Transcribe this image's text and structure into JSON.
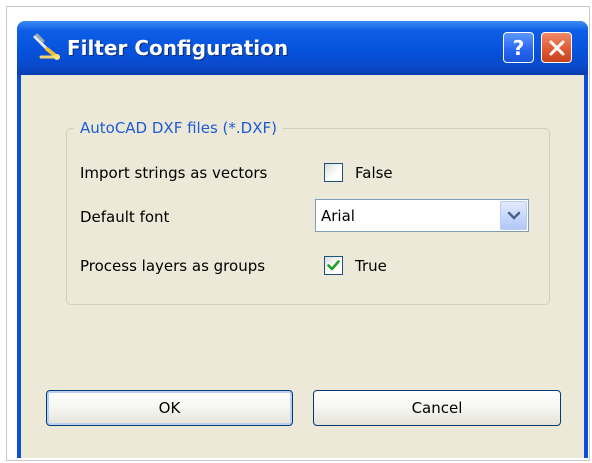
{
  "window": {
    "title": "Filter Configuration",
    "help_symbol": "?",
    "icon": "filter-wand-icon"
  },
  "group": {
    "title": "AutoCAD DXF files (*.DXF)",
    "rows": [
      {
        "label": "Import strings as vectors",
        "checked": false,
        "value_text": "False"
      },
      {
        "label": "Default font",
        "value": "Arial"
      },
      {
        "label": "Process layers as groups",
        "checked": true,
        "value_text": "True"
      }
    ]
  },
  "buttons": {
    "ok": "OK",
    "cancel": "Cancel"
  },
  "colors": {
    "titlebar": "#0a4fd6",
    "client": "#ece9d8",
    "group_title": "#1d5ad6",
    "close_button": "#e05a34",
    "checkmark": "#21a121"
  }
}
